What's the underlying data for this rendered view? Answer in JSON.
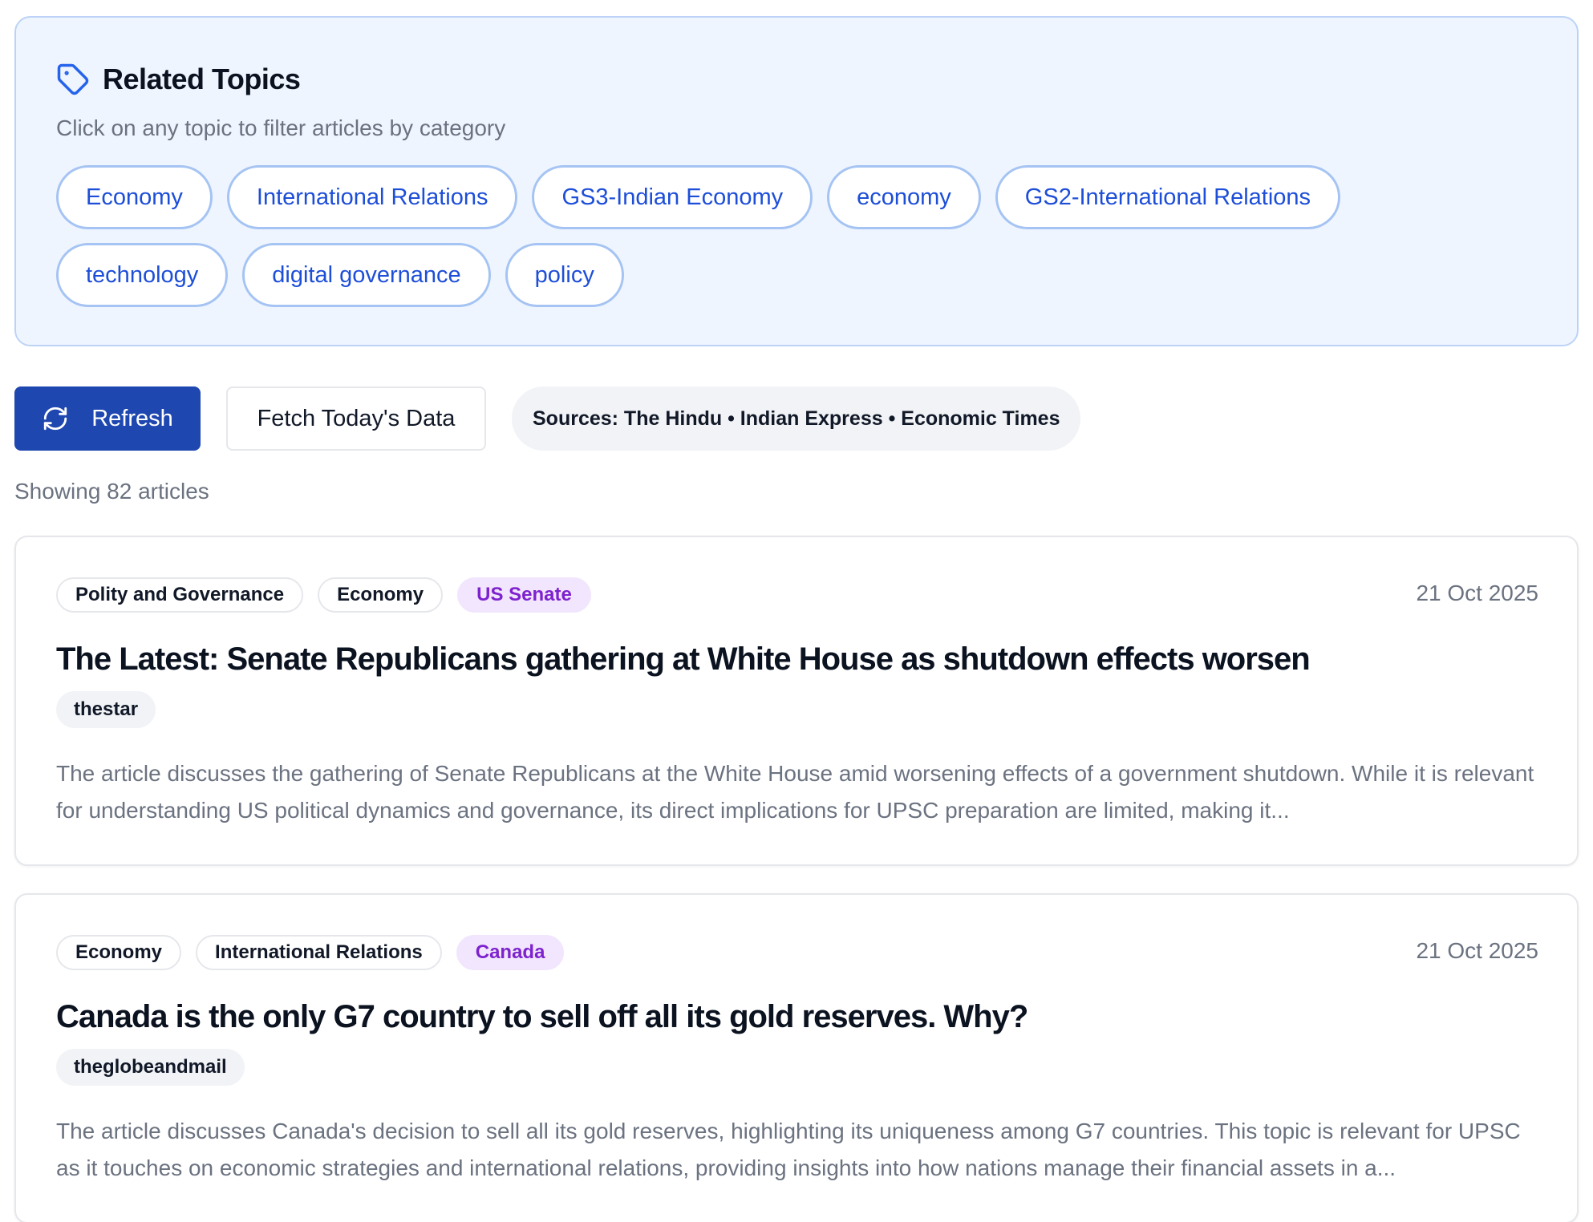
{
  "related_topics": {
    "title": "Related Topics",
    "subtitle": "Click on any topic to filter articles by category",
    "icon": "tag-icon",
    "accent_color": "#1d4ed8",
    "chips_row1": [
      "Economy",
      "International Relations",
      "GS3-Indian Economy",
      "economy",
      "GS2-International Relations"
    ],
    "chips_row2": [
      "technology",
      "digital governance",
      "policy"
    ]
  },
  "toolbar": {
    "refresh_label": "Refresh",
    "refresh_icon": "refresh-icon",
    "refresh_color": "#1e47b0",
    "fetch_label": "Fetch Today's Data",
    "sources_text": "Sources: The Hindu • Indian Express • Economic Times"
  },
  "results": {
    "count_text": "Showing 82 articles"
  },
  "articles": [
    {
      "tags": [
        "Polity and Governance",
        "Economy"
      ],
      "highlight_tag": "US Senate",
      "date": "21 Oct 2025",
      "title": "The Latest: Senate Republicans gathering at White House as shutdown effects worsen",
      "source": "thestar",
      "summary": "The article discusses the gathering of Senate Republicans at the White House amid worsening effects of a government shutdown. While it is relevant for understanding US political dynamics and governance, its direct implications for UPSC preparation are limited, making it..."
    },
    {
      "tags": [
        "Economy",
        "International Relations"
      ],
      "highlight_tag": "Canada",
      "date": "21 Oct 2025",
      "title": "Canada is the only G7 country to sell off all its gold reserves. Why?",
      "source": "theglobeandmail",
      "summary": "The article discusses Canada's decision to sell all its gold reserves, highlighting its uniqueness among G7 countries. This topic is relevant for UPSC as it touches on economic strategies and international relations, providing insights into how nations manage their financial assets in a..."
    }
  ]
}
